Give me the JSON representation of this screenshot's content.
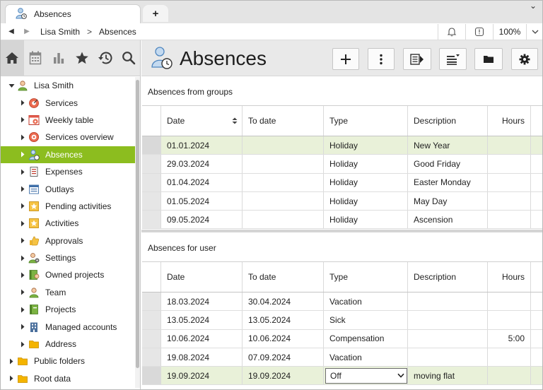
{
  "tab": {
    "title": "Absences",
    "new_tab_label": "+"
  },
  "window": {
    "chevron": "⌄"
  },
  "breadcrumb": {
    "user": "Lisa Smith",
    "separator": ">",
    "page": "Absences"
  },
  "address": {
    "zoom": "100%"
  },
  "sidebar": {
    "tabs": [
      "home-icon",
      "calendar-icon",
      "chart-icon",
      "star-icon",
      "history-icon",
      "search-icon"
    ],
    "tree": [
      {
        "label": "Lisa Smith",
        "level": 0,
        "expanded": true,
        "icon": "user-icon"
      },
      {
        "label": "Services",
        "level": 1,
        "icon": "services-icon"
      },
      {
        "label": "Weekly table",
        "level": 1,
        "icon": "weekly-table-icon"
      },
      {
        "label": "Services overview",
        "level": 1,
        "icon": "services-overview-icon"
      },
      {
        "label": "Absences",
        "level": 1,
        "icon": "absences-icon",
        "selected": true
      },
      {
        "label": "Expenses",
        "level": 1,
        "icon": "expenses-icon"
      },
      {
        "label": "Outlays",
        "level": 1,
        "icon": "outlays-icon"
      },
      {
        "label": "Pending activities",
        "level": 1,
        "icon": "pending-activities-icon"
      },
      {
        "label": "Activities",
        "level": 1,
        "icon": "activities-icon"
      },
      {
        "label": "Approvals",
        "level": 1,
        "icon": "approvals-icon"
      },
      {
        "label": "Settings",
        "level": 1,
        "icon": "settings-icon"
      },
      {
        "label": "Owned projects",
        "level": 1,
        "icon": "owned-projects-icon"
      },
      {
        "label": "Team",
        "level": 1,
        "icon": "team-icon"
      },
      {
        "label": "Projects",
        "level": 1,
        "icon": "projects-icon"
      },
      {
        "label": "Managed accounts",
        "level": 1,
        "icon": "managed-accounts-icon"
      },
      {
        "label": "Address",
        "level": 1,
        "icon": "address-icon"
      },
      {
        "label": "Public folders",
        "level": 0,
        "icon": "folder-icon"
      },
      {
        "label": "Root data",
        "level": 0,
        "icon": "folder-icon"
      }
    ]
  },
  "main": {
    "title": "Absences",
    "toolbar": [
      "add-icon",
      "more-icon",
      "export-icon",
      "list-filter-icon",
      "folder-icon",
      "gear-icon"
    ],
    "groups_section": {
      "title": "Absences from groups",
      "columns": [
        "Date",
        "To date",
        "Type",
        "Description",
        "Hours"
      ],
      "rows": [
        {
          "date": "01.01.2024",
          "to_date": "",
          "type": "Holiday",
          "description": "New Year",
          "hours": "",
          "highlight": true
        },
        {
          "date": "29.03.2024",
          "to_date": "",
          "type": "Holiday",
          "description": "Good Friday",
          "hours": ""
        },
        {
          "date": "01.04.2024",
          "to_date": "",
          "type": "Holiday",
          "description": "Easter Monday",
          "hours": ""
        },
        {
          "date": "01.05.2024",
          "to_date": "",
          "type": "Holiday",
          "description": "May Day",
          "hours": ""
        },
        {
          "date": "09.05.2024",
          "to_date": "",
          "type": "Holiday",
          "description": "Ascension",
          "hours": ""
        }
      ]
    },
    "user_section": {
      "title": "Absences for user",
      "columns": [
        "Date",
        "To date",
        "Type",
        "Description",
        "Hours"
      ],
      "rows": [
        {
          "date": "18.03.2024",
          "to_date": "30.04.2024",
          "type": "Vacation",
          "description": "",
          "hours": ""
        },
        {
          "date": "13.05.2024",
          "to_date": "13.05.2024",
          "type": "Sick",
          "description": "",
          "hours": ""
        },
        {
          "date": "10.06.2024",
          "to_date": "10.06.2024",
          "type": "Compensation",
          "description": "",
          "hours": "5:00"
        },
        {
          "date": "19.08.2024",
          "to_date": "07.09.2024",
          "type": "Vacation",
          "description": "",
          "hours": ""
        },
        {
          "date": "19.09.2024",
          "to_date": "19.09.2024",
          "type": "Off",
          "description": "moving flat",
          "hours": "",
          "highlight": true,
          "editing": true
        }
      ]
    }
  }
}
